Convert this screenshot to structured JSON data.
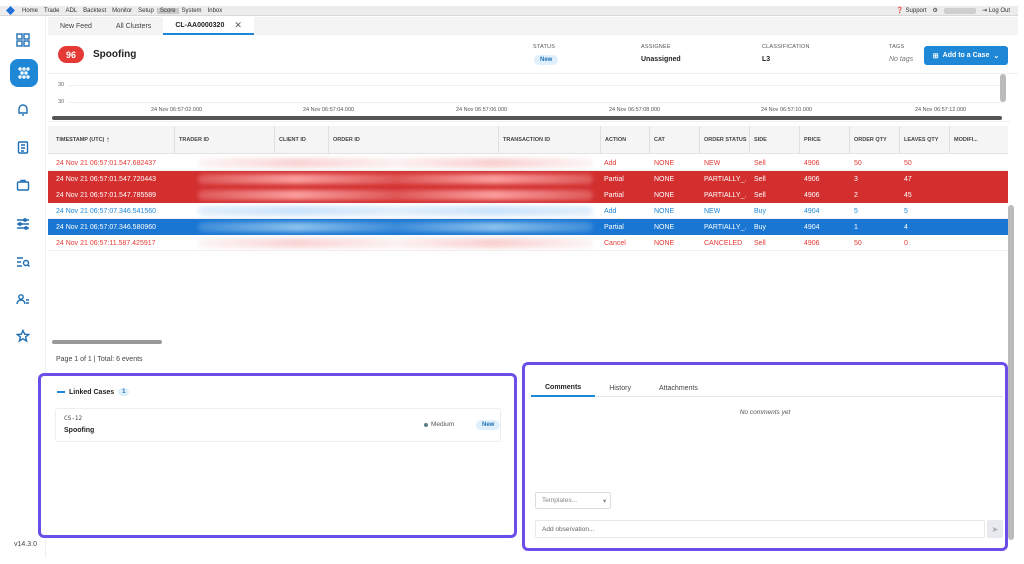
{
  "topbar": {
    "menu": [
      "Home",
      "Trade",
      "ADL",
      "Backtest",
      "Monitor",
      "Setup",
      "Score",
      "System",
      "Inbox"
    ],
    "active_menu": "Score",
    "support": "Support",
    "logout": "Log Out"
  },
  "rail": {
    "icons": [
      "dashboard-icon",
      "clusters-icon",
      "bell-icon",
      "clipboard-icon",
      "briefcase-icon",
      "sliders-icon",
      "search-list-icon",
      "users-icon",
      "star-icon"
    ],
    "version": "v14.3.0"
  },
  "tabs": [
    {
      "label": "New Feed"
    },
    {
      "label": "All Clusters"
    },
    {
      "label": "CL-AA0000320"
    }
  ],
  "header": {
    "score": "96",
    "title": "Spoofing",
    "status_label": "STATUS",
    "status_value": "New",
    "assignee_label": "ASSIGNEE",
    "assignee_value": "Unassigned",
    "classification_label": "CLASSIFICATION",
    "classification_value": "L3",
    "tags_label": "TAGS",
    "tags_value": "No tags",
    "add_case": "Add to a Case"
  },
  "timeline": {
    "y_labels": [
      "30",
      "30"
    ],
    "ticks": [
      "24 Nov 06:57:02.000",
      "24 Nov 06:57:04.000",
      "24 Nov 06:57:06.000",
      "24 Nov 06:57:08.000",
      "24 Nov 06:57:10.000",
      "24 Nov 06:57:12.000"
    ]
  },
  "grid": {
    "columns": [
      "TIMESTAMP (UTC)",
      "TRADER ID",
      "CLIENT ID",
      "ORDER ID",
      "TRANSACTION ID",
      "ACTION",
      "CAT",
      "ORDER STATUS",
      "SIDE",
      "PRICE",
      "ORDER QTY",
      "LEAVES QTY",
      "MODIFI..."
    ],
    "sort_indicator": "↑",
    "rows": [
      {
        "timestamp": "24 Nov 21 06:57:01.547.682437",
        "action": "Add",
        "cat": "NONE",
        "status": "NEW",
        "side": "Sell",
        "price": "4906",
        "qty": "50",
        "leaves": "50"
      },
      {
        "timestamp": "24 Nov 21 06:57:01.547.720443",
        "action": "Partial",
        "cat": "NONE",
        "status": "PARTIALLY_...",
        "side": "Sell",
        "price": "4906",
        "qty": "3",
        "leaves": "47"
      },
      {
        "timestamp": "24 Nov 21 06:57:01.547.785589",
        "action": "Partial",
        "cat": "NONE",
        "status": "PARTIALLY_...",
        "side": "Sell",
        "price": "4906",
        "qty": "2",
        "leaves": "45"
      },
      {
        "timestamp": "24 Nov 21 06:57:07.346.541560",
        "action": "Add",
        "cat": "NONE",
        "status": "NEW",
        "side": "Buy",
        "price": "4904",
        "qty": "5",
        "leaves": "5"
      },
      {
        "timestamp": "24 Nov 21 06:57:07.346.580960",
        "action": "Partial",
        "cat": "NONE",
        "status": "PARTIALLY_...",
        "side": "Buy",
        "price": "4904",
        "qty": "1",
        "leaves": "4"
      },
      {
        "timestamp": "24 Nov 21 06:57:11.587.425917",
        "action": "Cancel",
        "cat": "NONE",
        "status": "CANCELED",
        "side": "Sell",
        "price": "4906",
        "qty": "50",
        "leaves": "0"
      }
    ],
    "pager": "Page 1 of 1 | Total: 6 events"
  },
  "linked": {
    "title": "Linked Cases",
    "count": "1",
    "case_id": "CS-12",
    "case_name": "Spoofing",
    "priority": "Medium",
    "status": "New"
  },
  "comments": {
    "tabs": [
      "Comments",
      "History",
      "Attachments"
    ],
    "empty": "No comments yet",
    "templates_placeholder": "Templates...",
    "observation_placeholder": "Add observation..."
  }
}
